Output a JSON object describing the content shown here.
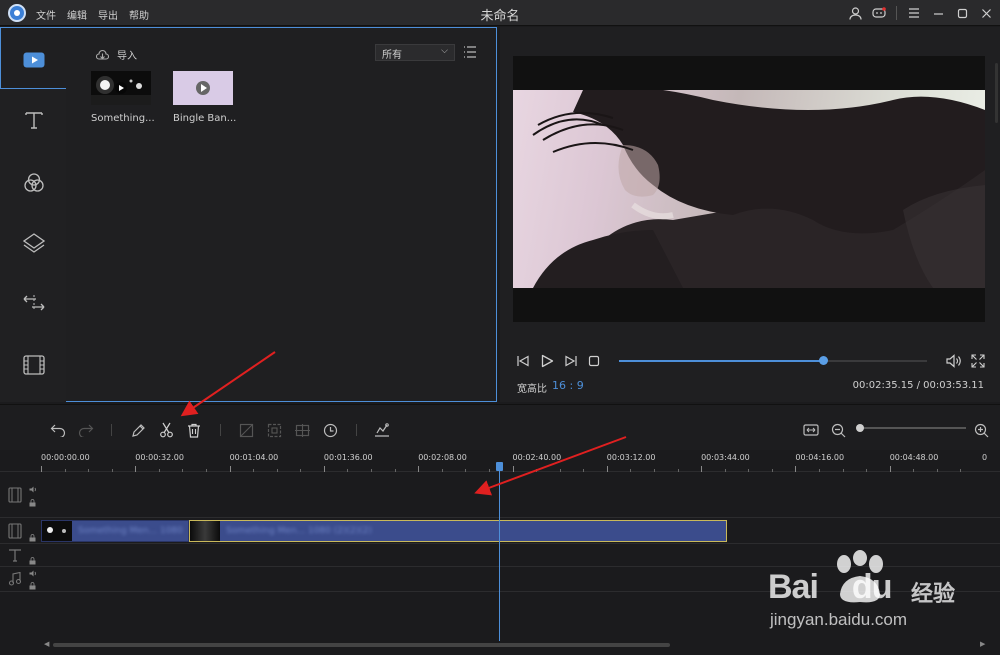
{
  "app": {
    "title": "未命名",
    "menu": [
      "文件",
      "编辑",
      "导出",
      "帮助"
    ]
  },
  "rail": {
    "items": [
      {
        "name": "media",
        "icon": "video-icon",
        "active": true
      },
      {
        "name": "text",
        "icon": "text-icon",
        "active": false
      },
      {
        "name": "filters",
        "icon": "filter-icon",
        "active": false
      },
      {
        "name": "overlays",
        "icon": "layers-icon",
        "active": false
      },
      {
        "name": "transitions",
        "icon": "transition-icon",
        "active": false
      },
      {
        "name": "elements",
        "icon": "film-icon",
        "active": false
      }
    ]
  },
  "library": {
    "import_label": "导入",
    "filter_value": "所有",
    "items": [
      {
        "label": "Something...",
        "type": "video"
      },
      {
        "label": "Bingle Ban...",
        "type": "audio"
      }
    ]
  },
  "preview": {
    "aspect_label": "宽高比",
    "aspect_value": "16 : 9",
    "timecode": "00:02:35.15 / 00:03:53.11",
    "progress": 0.663
  },
  "timeline": {
    "ruler_labels": [
      "00:00:00.00",
      "00:00:32.00",
      "00:01:04.00",
      "00:01:36.00",
      "00:02:08.00",
      "00:02:40.00",
      "00:03:12.00",
      "00:03:44.00",
      "00:04:16.00",
      "00:04:48.00",
      "0"
    ],
    "zoom_level": 0.0,
    "clips": [
      {
        "name": "Something Men... 1080"
      },
      {
        "name": "Something Men... 1080 (2)(2)(2)"
      }
    ]
  },
  "watermark": {
    "brand": "Bai",
    "brand_tail": "du",
    "suffix": "经验",
    "url": "jingyan.baidu.com"
  },
  "colors": {
    "accent": "#4d8fd9",
    "arrow": "#e02020",
    "clip": "#3b4c8c",
    "clip_selected_border": "#c9b95a"
  }
}
